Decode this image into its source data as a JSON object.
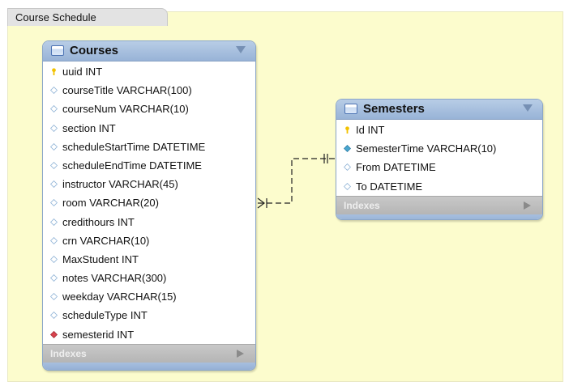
{
  "diagram_tab": {
    "label": "Course Schedule"
  },
  "courses": {
    "title": "Courses",
    "indexes_label": "Indexes",
    "columns": [
      {
        "label": "uuid INT",
        "kind": "primary-key"
      },
      {
        "label": "courseTitle VARCHAR(100)",
        "kind": "column"
      },
      {
        "label": "courseNum VARCHAR(10)",
        "kind": "column"
      },
      {
        "label": "section INT",
        "kind": "column"
      },
      {
        "label": "scheduleStartTime DATETIME",
        "kind": "column"
      },
      {
        "label": "scheduleEndTime DATETIME",
        "kind": "column"
      },
      {
        "label": "instructor VARCHAR(45)",
        "kind": "column"
      },
      {
        "label": "room VARCHAR(20)",
        "kind": "column"
      },
      {
        "label": "credithours INT",
        "kind": "column"
      },
      {
        "label": "crn VARCHAR(10)",
        "kind": "column"
      },
      {
        "label": "MaxStudent INT",
        "kind": "column"
      },
      {
        "label": "notes VARCHAR(300)",
        "kind": "column"
      },
      {
        "label": "weekday VARCHAR(15)",
        "kind": "column"
      },
      {
        "label": "scheduleType INT",
        "kind": "column"
      },
      {
        "label": "semesterid INT",
        "kind": "foreign-key"
      }
    ]
  },
  "semesters": {
    "title": "Semesters",
    "indexes_label": "Indexes",
    "columns": [
      {
        "label": "Id INT",
        "kind": "primary-key"
      },
      {
        "label": "SemesterTime VARCHAR(10)",
        "kind": "not-null-column"
      },
      {
        "label": "From DATETIME",
        "kind": "column"
      },
      {
        "label": "To DATETIME",
        "kind": "column"
      }
    ]
  },
  "colors": {
    "canvas": "#fcfccd",
    "header": "#a8c0e0",
    "primary_key": "#f2c200",
    "foreign_key": "#d9434d",
    "not_null_column": "#4aa6cf",
    "column": "#8fb3d6"
  }
}
